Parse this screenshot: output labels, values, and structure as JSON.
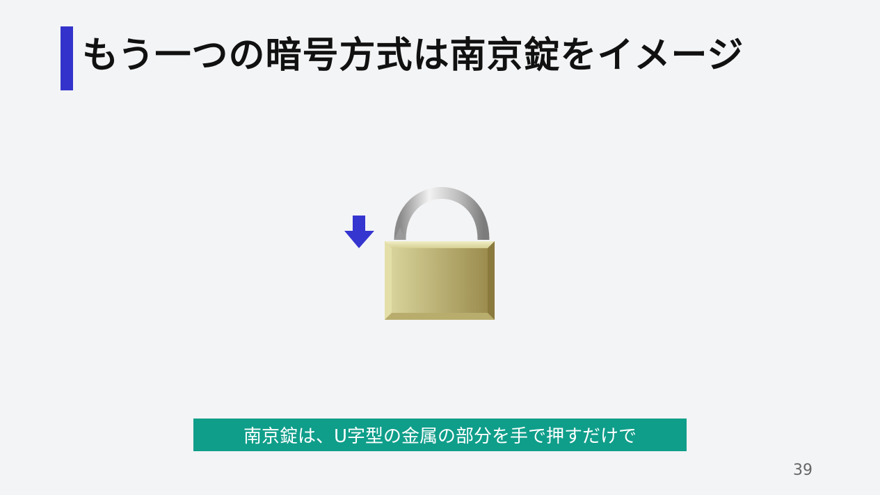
{
  "slide": {
    "title": "もう一つの暗号方式は南京錠をイメージ",
    "caption": "南京錠は、U字型の金属の部分を手で押すだけで",
    "page_number": "39"
  },
  "colors": {
    "accent_bar": "#3333cc",
    "caption_bg": "#0f9e8a",
    "arrow": "#3535d0",
    "lock_body_light": "#d9d59a",
    "lock_body_dark": "#9a8a4c",
    "shackle": "#b8b8b8"
  },
  "icons": {
    "arrow": "down-arrow-icon",
    "lock": "padlock-icon"
  }
}
